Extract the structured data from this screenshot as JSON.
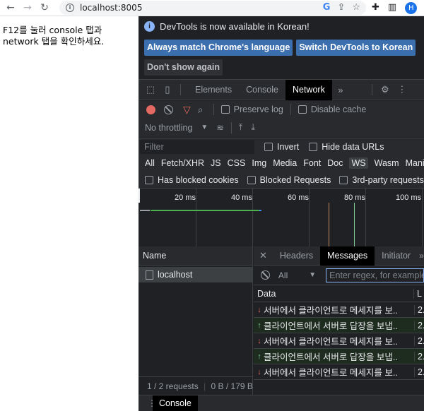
{
  "browser": {
    "url": "localhost:8005",
    "avatar_letter": "H"
  },
  "page": {
    "text": "F12를 눌러 console 탭과 network 탭을 확인하세요."
  },
  "devtools": {
    "banner": {
      "message": "DevTools is now available in Korean!",
      "btn_match": "Always match Chrome's language",
      "btn_switch": "Switch DevTools to Korean",
      "btn_dont_show": "Don't show again"
    },
    "tabs": [
      "Elements",
      "Console",
      "Network"
    ],
    "active_tab": "Network",
    "toolbar": {
      "preserve_log": "Preserve log",
      "disable_cache": "Disable cache",
      "throttling": "No throttling"
    },
    "filter": {
      "placeholder": "Filter",
      "invert": "Invert",
      "hide_data_urls": "Hide data URLs"
    },
    "types": [
      "All",
      "Fetch/XHR",
      "JS",
      "CSS",
      "Img",
      "Media",
      "Font",
      "Doc",
      "WS",
      "Wasm",
      "Manifest"
    ],
    "active_type": "WS",
    "options": {
      "blocked_cookies": "Has blocked cookies",
      "blocked_requests": "Blocked Requests",
      "third_party": "3rd-party requests"
    },
    "timeline_ticks": [
      "20 ms",
      "40 ms",
      "60 ms",
      "80 ms",
      "100 ms"
    ],
    "requests": {
      "header": "Name",
      "items": [
        "localhost"
      ],
      "status": "1 / 2 requests",
      "transfer": "0 B / 179 B"
    },
    "detail_tabs": [
      "Headers",
      "Messages",
      "Initiator"
    ],
    "active_detail_tab": "Messages",
    "messages": {
      "filter_all": "All",
      "regex_placeholder": "Enter regex, for example",
      "col_data": "Data",
      "col_length": "L",
      "rows": [
        {
          "dir": "down",
          "text": "서버에서 클라이언트로 메세지를 보..",
          "len": "2."
        },
        {
          "dir": "up",
          "text": "클라이언트에서 서버로 답장을 보냅..",
          "len": "2."
        },
        {
          "dir": "down",
          "text": "서버에서 클라이언트로 메세지를 보..",
          "len": "2."
        },
        {
          "dir": "up",
          "text": "클라이언트에서 서버로 답장을 보냅..",
          "len": "2."
        },
        {
          "dir": "down",
          "text": "서버에서 클라이언트로 메세지를 보..",
          "len": "2."
        }
      ]
    },
    "drawer_tab": "Console"
  },
  "colors": {
    "devtools_bg": "#202124",
    "record_red": "#e46962",
    "button_blue": "#3b6fae"
  }
}
